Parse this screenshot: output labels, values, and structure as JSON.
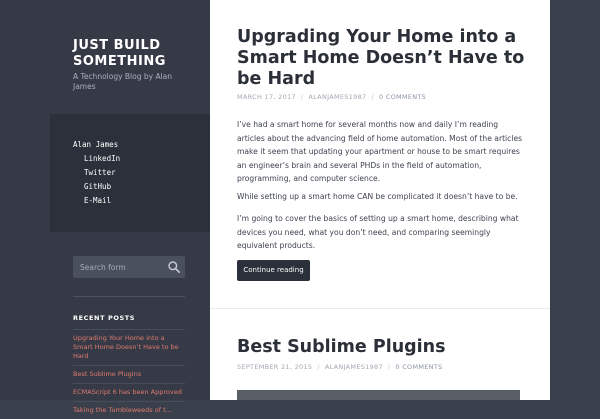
{
  "sidebar": {
    "site_title": "JUST BUILD SOMETHING",
    "site_description": "A Technology Blog by Alan James",
    "social": {
      "owner": "Alan James",
      "links": [
        "LinkedIn",
        "Twitter",
        "GitHub",
        "E-Mail"
      ]
    },
    "search": {
      "placeholder": "Search form"
    },
    "recent_posts": {
      "title": "RECENT POSTS",
      "items": [
        "Upgrading Your Home into a Smart Home Doesn’t Have to be Hard",
        "Best Sublime Plugins",
        "ECMAScript 6 has been Approved",
        "Taking the Tumbleweeds of t..."
      ]
    }
  },
  "posts": [
    {
      "title": "Upgrading Your Home into a Smart Home Doesn’t Have to be Hard",
      "date": "MARCH 17, 2017",
      "author": "ALANJAMES1987",
      "comments": "0 COMMENTS",
      "paragraphs": [
        "I’ve had a smart home for several months now and daily I’m reading articles about the advancing field of home automation. Most of the articles make it seem that updating your apartment or house to be smart requires an engineer’s brain and several PHDs in the field of automation, programming, and computer science.",
        "While setting up a smart home CAN be complicated it doesn’t have to be.",
        "I’m going to cover the basics of setting up a smart home, describing what devices you need, what you don’t need, and comparing seemingly equivalent products."
      ],
      "cta": "Continue reading"
    },
    {
      "title": "Best Sublime Plugins",
      "date": "SEPTEMBER 21, 2015",
      "author": "ALANJAMES1987",
      "comments": "0 COMMENTS"
    }
  ],
  "colors": {
    "sidebar_bg": "#353a46",
    "social_box_bg": "#2b303b",
    "accent_link": "#e07a6e",
    "button_bg": "#2b303b"
  }
}
